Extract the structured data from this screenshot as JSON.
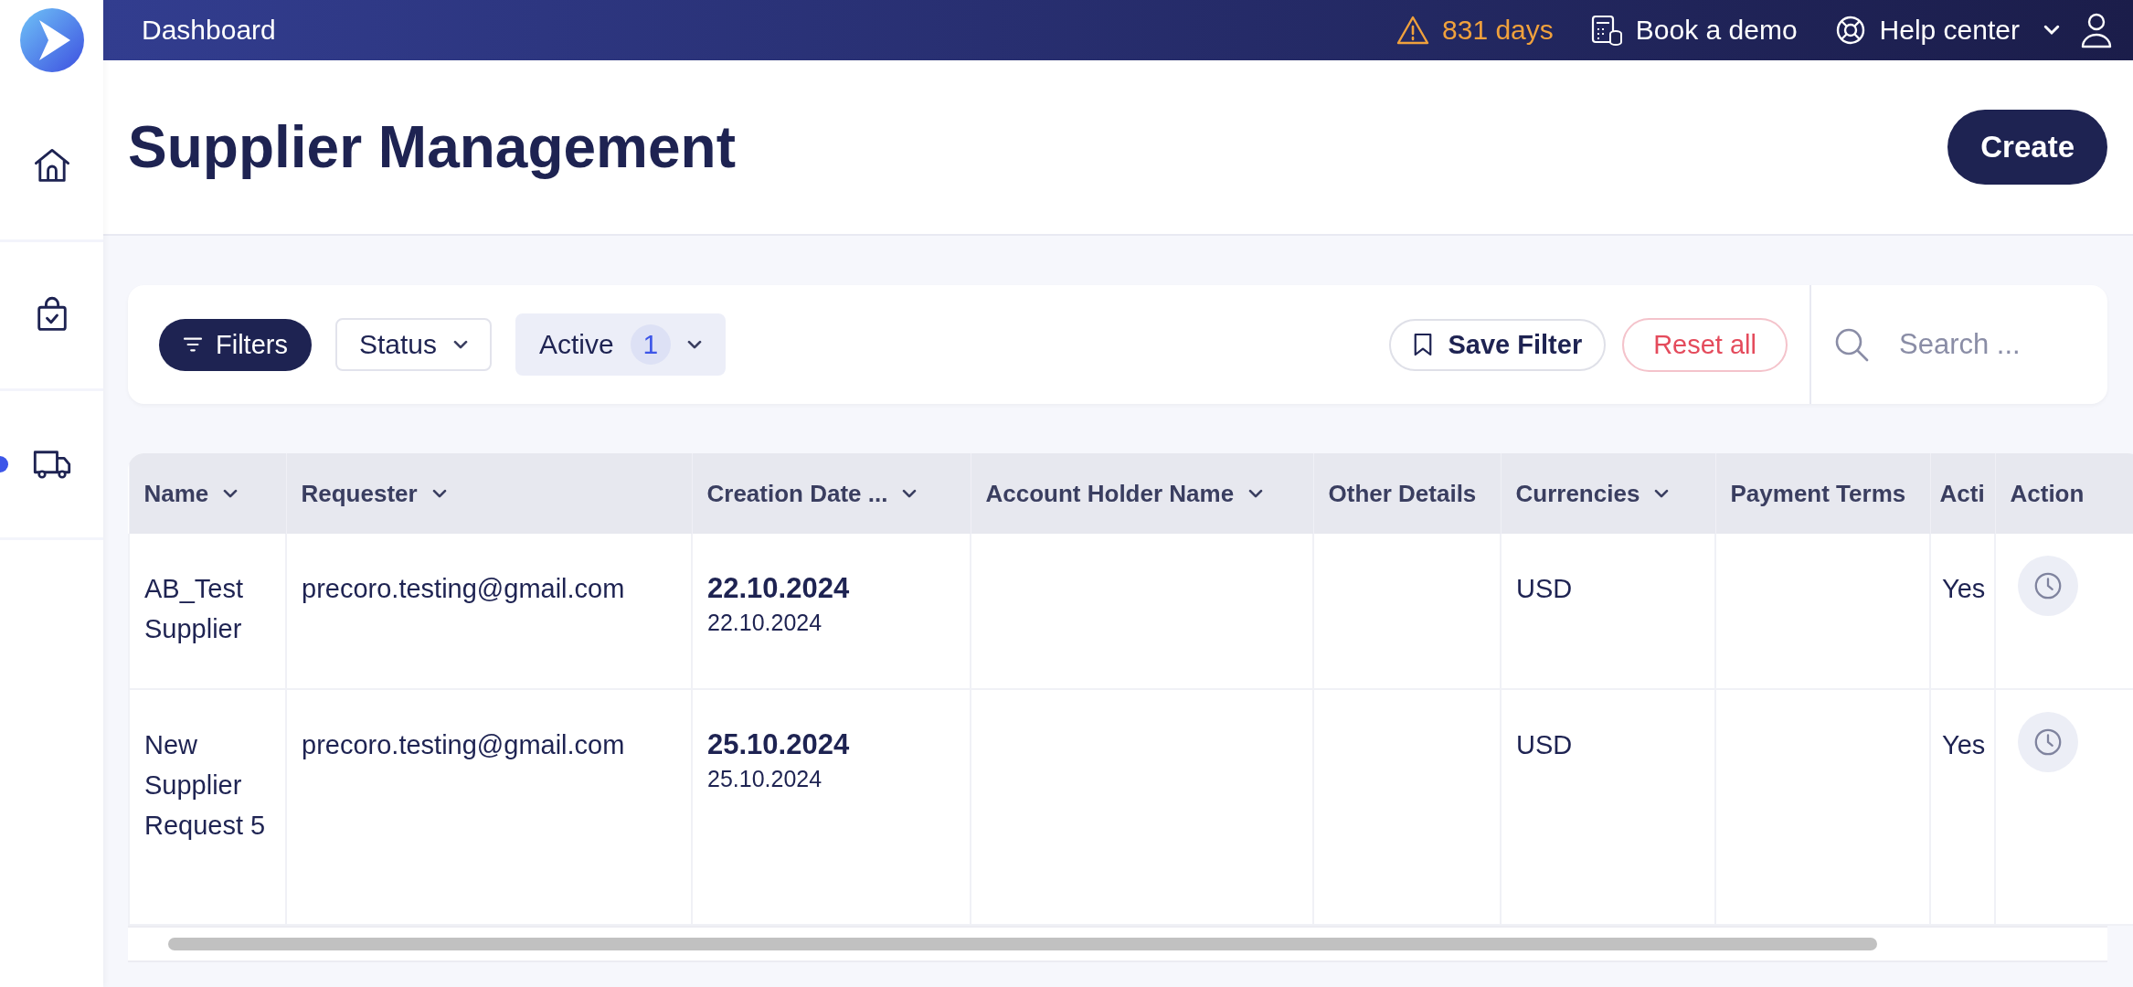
{
  "top_bar": {
    "title": "Dashboard",
    "alert": "831 days",
    "links": [
      {
        "kind": "demo",
        "label": "Book a demo"
      },
      {
        "kind": "help",
        "label": "Help center"
      }
    ]
  },
  "sidebar": {
    "items": [
      {
        "kind": "home",
        "selected": false
      },
      {
        "kind": "bag",
        "selected": false
      },
      {
        "kind": "truck",
        "selected": true
      }
    ]
  },
  "page": {
    "title": "Supplier Management",
    "create_button": "Create"
  },
  "filters": {
    "filters_button": "Filters",
    "chips": [
      {
        "label": "Status",
        "filled": false
      },
      {
        "label": "Active",
        "count": "1",
        "filled": true
      }
    ],
    "save_button": "Save Filter",
    "reset_button": "Reset all",
    "search": {
      "placeholder": "Search ..."
    }
  },
  "table": {
    "columns": [
      {
        "label": "Name",
        "sortable": true
      },
      {
        "label": "Requester",
        "sortable": true
      },
      {
        "label": "Creation Date ...",
        "sortable": true
      },
      {
        "label": "Account Holder Name",
        "sortable": true
      },
      {
        "label": "Other Details",
        "sortable": false
      },
      {
        "label": "Currencies",
        "sortable": true
      },
      {
        "label": "Payment Terms",
        "sortable": false
      },
      {
        "label": "Acti",
        "sortable": false
      },
      {
        "label": "Action",
        "sortable": false
      }
    ],
    "rows": [
      {
        "name": "AB_Test Supplier",
        "requester": "precoro.testing@gmail.com",
        "date_main": "22.10.2024",
        "date_sub": "22.10.2024",
        "currencies": "USD",
        "active": "Yes"
      },
      {
        "name": "New Supplier Request 5",
        "requester": "precoro.testing@gmail.com",
        "date_main": "25.10.2024",
        "date_sub": "25.10.2024",
        "currencies": "USD",
        "active": "Yes"
      }
    ]
  }
}
